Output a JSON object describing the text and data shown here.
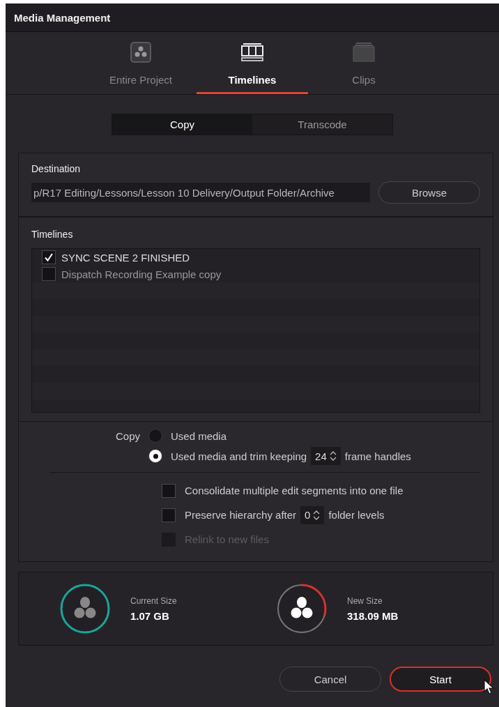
{
  "window": {
    "title": "Media Management"
  },
  "tabs": [
    {
      "label": "Entire Project",
      "selected": false
    },
    {
      "label": "Timelines",
      "selected": true
    },
    {
      "label": "Clips",
      "selected": false
    }
  ],
  "mode": [
    {
      "label": "Copy",
      "selected": true
    },
    {
      "label": "Transcode",
      "selected": false
    }
  ],
  "destination": {
    "heading": "Destination",
    "value": "p/R17 Editing/Lessons/Lesson 10 Delivery/Output Folder/Archive",
    "button": "Browse"
  },
  "timelines": {
    "heading": "Timelines",
    "items": [
      {
        "label": "SYNC SCENE 2 FINISHED",
        "checked": true
      },
      {
        "label": "Dispatch Recording Example copy",
        "checked": false
      }
    ]
  },
  "copy_options": {
    "label": "Copy",
    "choices": [
      {
        "label": "Used media",
        "selected": false
      },
      {
        "label": "Used media and trim keeping",
        "selected": true,
        "spinner": "24",
        "suffix": "frame handles"
      }
    ]
  },
  "checkboxes": [
    {
      "label": "Consolidate multiple edit segments into one file",
      "checked": false,
      "disabled": false
    },
    {
      "label": "Preserve hierarchy after",
      "checked": false,
      "disabled": false,
      "spinner": "0",
      "suffix": "folder levels"
    },
    {
      "label": "Relink to new files",
      "checked": false,
      "disabled": true
    }
  ],
  "sizes": [
    {
      "label": "Current Size",
      "value": "1.07 GB",
      "level": 1,
      "color": "#17a59c"
    },
    {
      "label": "New Size",
      "value": "318.09 MB",
      "level": 0.3,
      "color": "#d9302c"
    }
  ],
  "buttons": [
    {
      "label": "Cancel",
      "kind": "secondary"
    },
    {
      "label": "Start",
      "kind": "primary"
    }
  ]
}
